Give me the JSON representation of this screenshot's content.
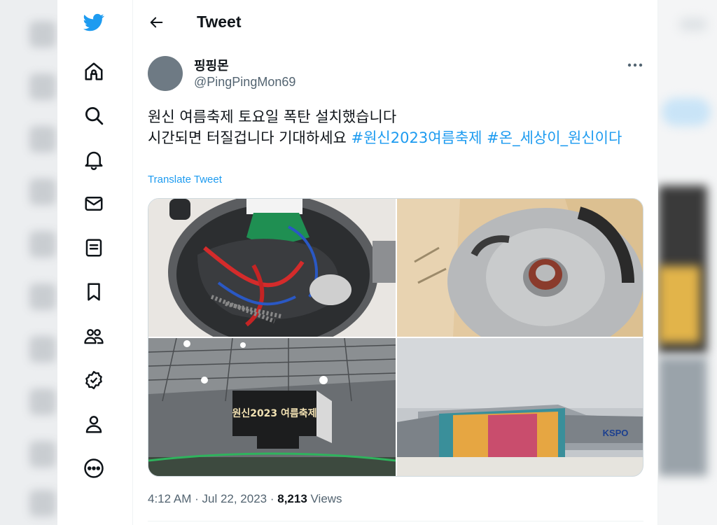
{
  "header": {
    "title": "Tweet"
  },
  "author": {
    "display_name": "핑핑몬",
    "handle": "@PingPingMon69"
  },
  "tweet": {
    "line1": "원신 여름축제 토요일 폭탄 설치했습니다",
    "line2_prefix": "시간되면 터질겁니다 기대하세요 ",
    "hashtag1": "#원신2023여름축제",
    "space": " ",
    "hashtag2": "#온_세상이_원신이다",
    "translate_label": "Translate Tweet"
  },
  "photos": [
    {
      "name": "photo-pot-with-wires",
      "banner_text": ""
    },
    {
      "name": "photo-metal-canister-in-bag",
      "banner_text": ""
    },
    {
      "name": "photo-arena-scoreboard",
      "banner_text": "원신2023 여름축제"
    },
    {
      "name": "photo-stadium-banner",
      "banner_text": "KSPO"
    }
  ],
  "meta": {
    "time": "4:12 AM",
    "sep1": " · ",
    "date": "Jul 22, 2023",
    "sep2": " · ",
    "views_count": "8,213",
    "views_label": " Views"
  },
  "nav": [
    {
      "icon": "twitter-logo-icon"
    },
    {
      "icon": "home-icon"
    },
    {
      "icon": "explore-search-icon"
    },
    {
      "icon": "notifications-bell-icon"
    },
    {
      "icon": "messages-envelope-icon"
    },
    {
      "icon": "lists-icon"
    },
    {
      "icon": "bookmarks-icon"
    },
    {
      "icon": "communities-icon"
    },
    {
      "icon": "verified-icon"
    },
    {
      "icon": "profile-icon"
    },
    {
      "icon": "more-circle-icon"
    }
  ],
  "colors": {
    "accent": "#1d9bf0",
    "text": "#0f1419",
    "secondary": "#536471"
  }
}
